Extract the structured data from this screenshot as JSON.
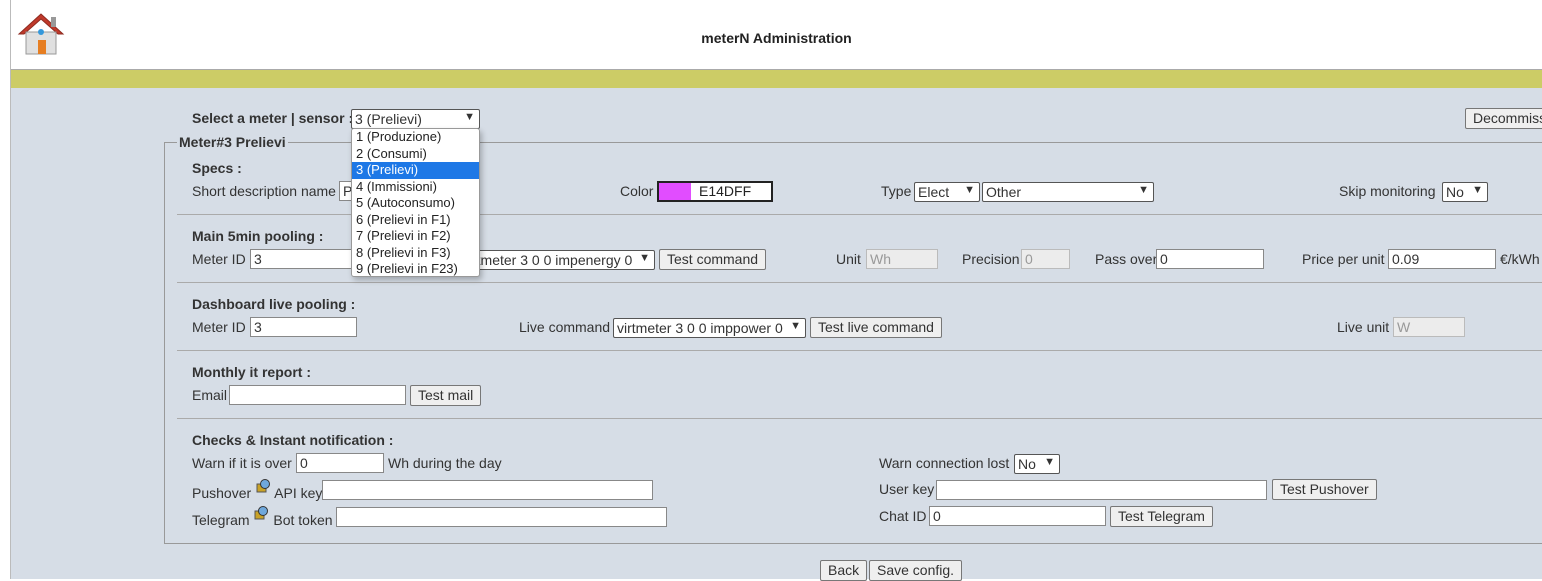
{
  "header": {
    "title": "meterN Administration",
    "accent": "#cccc66"
  },
  "select_meter": {
    "label": "Select a meter | sensor :",
    "value": "3 (Prelievi)",
    "options": [
      "1 (Produzione)",
      "2 (Consumi)",
      "3 (Prelievi)",
      "4 (Immissioni)",
      "5 (Autoconsumo)",
      "6 (Prelievi in F1)",
      "7 (Prelievi in F2)",
      "8 (Prelievi in F3)",
      "9 (Prelievi in F23)"
    ],
    "decommission_label": "Decommiss"
  },
  "meter": {
    "legend": "Meter#3 Prelievi",
    "specs": {
      "heading": "Specs :",
      "short_desc_label": "Short description name",
      "short_desc_value": "P",
      "color_label": "Color",
      "color_value": "E14DFF",
      "color_hex": "#e14dff",
      "type_label": "Type",
      "type_value": "Elect",
      "type2_value": "Other",
      "skip_label": "Skip monitoring",
      "skip_value": "No"
    },
    "main": {
      "heading": "Main 5min pooling :",
      "meter_id_label": "Meter ID",
      "meter_id_value": "3",
      "command_value": "rtmeter 3 0 0 impenergy 0",
      "test_command": "Test command",
      "unit_label": "Unit",
      "unit_value": "Wh",
      "precision_label": "Precision",
      "precision_value": "0",
      "passover_label": "Pass over",
      "passover_value": "0",
      "price_label": "Price per unit",
      "price_value": "0.09",
      "price_unit": "€/kWh"
    },
    "live": {
      "heading": "Dashboard live pooling :",
      "meter_id_label": "Meter ID",
      "meter_id_value": "3",
      "command_label": "Live command",
      "command_value": "virtmeter 3 0 0 imppower 0",
      "test_label": "Test live command",
      "unit_label": "Live unit",
      "unit_value": "W"
    },
    "report": {
      "heading": "Monthly it report :",
      "email_label": "Email",
      "email_value": "",
      "test_mail": "Test mail"
    },
    "checks": {
      "heading": "Checks & Instant notification :",
      "warn_label": "Warn if it is over",
      "warn_value": "0",
      "warn_suffix": "Wh during the day",
      "conn_lost_label": "Warn connection lost",
      "conn_lost_value": "No",
      "pushover_label": "Pushover",
      "api_key_label": "API key",
      "api_key_value": "",
      "user_key_label": "User key",
      "user_key_value": "",
      "test_pushover": "Test Pushover",
      "telegram_label": "Telegram",
      "bot_token_label": "Bot token",
      "bot_token_value": "",
      "chat_id_label": "Chat ID",
      "chat_id_value": "0",
      "test_telegram": "Test Telegram"
    }
  },
  "footer": {
    "back": "Back",
    "save": "Save config."
  }
}
